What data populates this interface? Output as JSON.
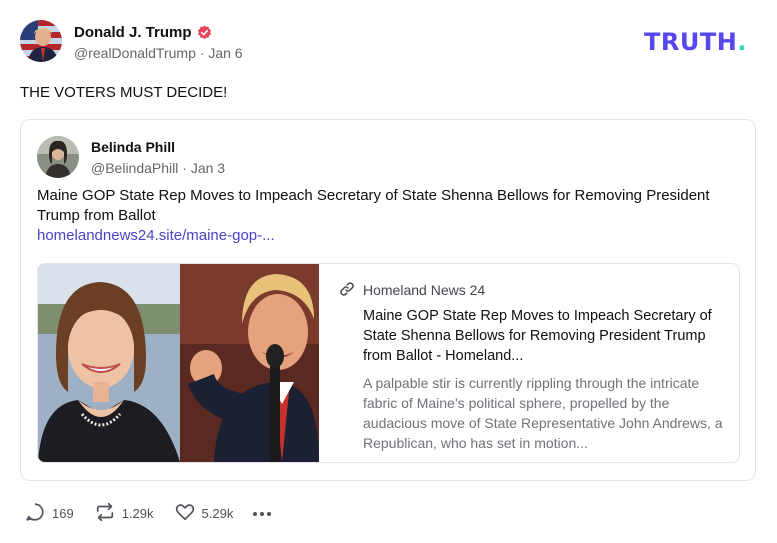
{
  "post": {
    "author_name": "Donald J. Trump",
    "handle": "@realDonaldTrump",
    "date": "Jan 6",
    "text": "THE VOTERS MUST DECIDE!"
  },
  "brand": {
    "logo_text": "TRUTH",
    "logo_dot": ".",
    "accent_color": "#5448ee",
    "dot_color": "#34d4c0"
  },
  "quote": {
    "author_name": "Belinda Phill",
    "handle": "@BelindaPhill",
    "date": "Jan 3",
    "text": "Maine GOP State Rep Moves to Impeach Secretary of State Shenna Bellows for Removing President Trump from Ballot",
    "link_text": "homelandnews24.site/maine-gop-..."
  },
  "card": {
    "source": "Homeland News 24",
    "title": "Maine GOP State Rep Moves to Impeach Secretary of State Shenna Bellows for Removing President Trump from Ballot - Homeland...",
    "description": "A palpable stir is currently rippling through the intricate fabric of Maine’s political sphere, propelled by the audacious move of State Representative John Andrews, a Republican, who has set in motion..."
  },
  "actions": {
    "replies": "169",
    "retruths": "1.29k",
    "likes": "5.29k"
  },
  "icons": [
    "verified-badge-icon",
    "link-icon",
    "reply-icon",
    "retruth-icon",
    "heart-icon",
    "more-icon"
  ]
}
